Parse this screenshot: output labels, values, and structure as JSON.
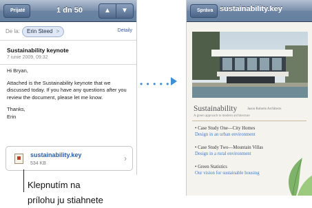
{
  "mail": {
    "back_label": "Prijaté",
    "count_label": "1 dn 50",
    "up_label": "▲",
    "down_label": "▼",
    "from_label": "De la:",
    "from_name": "Erin Steed",
    "from_chevron": ">",
    "details_label": "Detaily",
    "subject": "Sustainability keynote",
    "date": "7 iunie 2009, 09:32",
    "greeting": "Hi Bryan,",
    "body": "Attached is the Sustainability keynote that we discussed today. If you have any questions after you review the document, please let me know.",
    "closing": "Thanks,",
    "signature": "Erin",
    "attachment_name": "sustainability.key",
    "attachment_size": "534 KB",
    "attachment_chevron": "›"
  },
  "callout": {
    "line1": "Klepnutím na",
    "line2": "prílohu ju stiahnete"
  },
  "viewer": {
    "back_label": "Správa",
    "title": "sustainability.key",
    "doc_heading": "Sustainability",
    "doc_heading_sub": "Jason Roberts Architects",
    "doc_tagline": "A green approach to modern architecture",
    "cases": [
      {
        "title": "• Case Study One—City Homes",
        "subtitle": "Design in an urban environment"
      },
      {
        "title": "• Case Study Two—Mountain Villas",
        "subtitle": "Design in a rural environment"
      },
      {
        "title": "• Green Statistics",
        "subtitle": "Our vision for sustainable housing"
      }
    ]
  },
  "icons": {
    "arrow": "dotted-arrow-right",
    "attachment": "keynote-file-icon"
  },
  "colors": {
    "navbar": "#6d84a3",
    "link": "#2b5ea8",
    "arrow": "#3f8fd8"
  }
}
